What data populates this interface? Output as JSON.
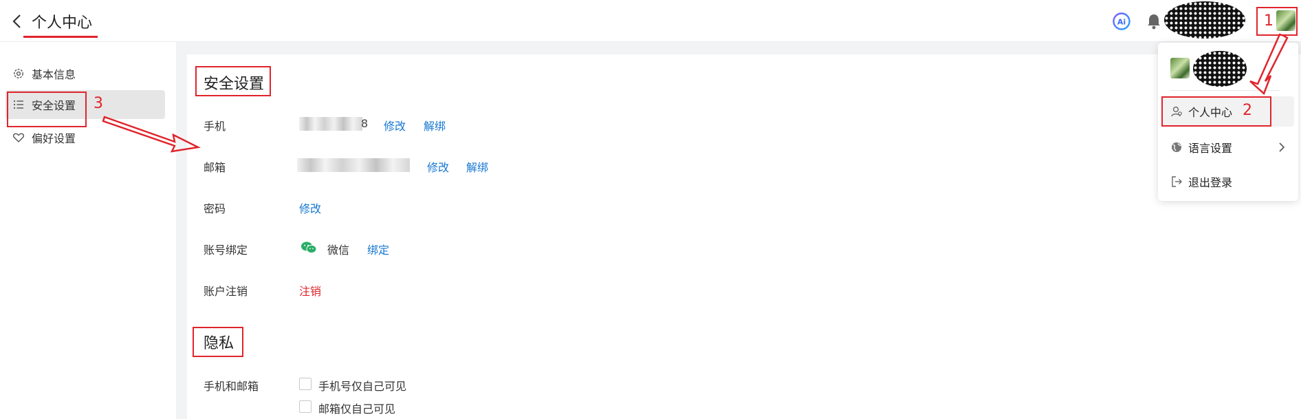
{
  "header": {
    "title": "个人中心"
  },
  "sidebar": {
    "items": [
      {
        "label": "基本信息",
        "icon": "gear-icon"
      },
      {
        "label": "安全设置",
        "icon": "list-icon",
        "active": true
      },
      {
        "label": "偏好设置",
        "icon": "heart-icon"
      }
    ]
  },
  "security": {
    "title": "安全设置",
    "phone": {
      "label": "手机",
      "value_tail": "8",
      "edit": "修改",
      "unbind": "解绑"
    },
    "email": {
      "label": "邮箱",
      "edit": "修改",
      "unbind": "解绑"
    },
    "password": {
      "label": "密码",
      "edit": "修改"
    },
    "binding": {
      "label": "账号绑定",
      "platform": "微信",
      "action": "绑定"
    },
    "cancel": {
      "label": "账户注销",
      "action": "注销"
    }
  },
  "privacy": {
    "title": "隐私",
    "phone_email": {
      "label": "手机和邮箱",
      "options": [
        {
          "label": "手机号仅自己可见",
          "checked": false
        },
        {
          "label": "邮箱仅自己可见",
          "checked": false
        }
      ]
    }
  },
  "dropdown": {
    "items": [
      {
        "label": "个人中心",
        "icon": "user-icon"
      },
      {
        "label": "语言设置",
        "icon": "globe-icon",
        "has_submenu": true
      },
      {
        "label": "退出登录",
        "icon": "logout-icon"
      }
    ]
  },
  "annotations": {
    "color": "#e0242b",
    "numbers": [
      "1",
      "2",
      "3"
    ]
  },
  "colors": {
    "link": "#1677d2",
    "danger": "#e0242b",
    "wechat": "#2aae67"
  }
}
